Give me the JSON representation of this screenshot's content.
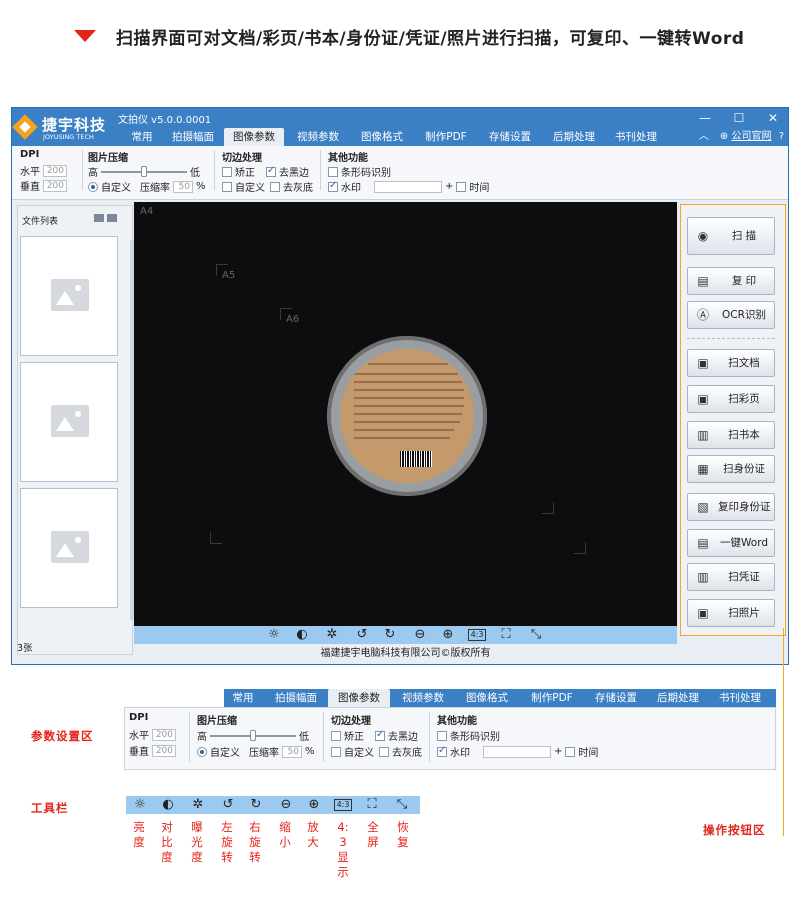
{
  "banner": {
    "text": "扫描界面可对文档/彩页/书本/身份证/凭证/照片进行扫描，可复印、一键转Word"
  },
  "app": {
    "logo_cn": "捷宇科技",
    "logo_en": "JOYUSING TECH",
    "title": "文拍仪 v5.0.0.0001",
    "tabs": [
      "常用",
      "拍摄幅面",
      "图像参数",
      "视频参数",
      "图像格式",
      "制作PDF",
      "存储设置",
      "后期处理",
      "书刊处理"
    ],
    "active_tab": "图像参数",
    "official_site": "公司官网",
    "colors": {
      "titlebar": "#3b7fc4",
      "accent": "#f5a623",
      "toolbar": "#9cc9ef",
      "annotation": "#e5231b"
    }
  },
  "params": {
    "dpi": {
      "title": "DPI",
      "h_label": "水平",
      "h_value": "200",
      "v_label": "垂直",
      "v_value": "200"
    },
    "compress": {
      "title": "图片压缩",
      "high": "高",
      "low": "低",
      "custom": "自定义",
      "rate_label": "压缩率",
      "rate_value": "50",
      "unit": "%",
      "level": 0.5
    },
    "crop": {
      "title": "切边处理",
      "correct": "矫正",
      "correct_checked": false,
      "remove_black": "去黑边",
      "remove_black_checked": true,
      "custom": "自定义",
      "custom_checked": false,
      "remove_gray": "去灰底",
      "remove_gray_checked": false
    },
    "other": {
      "title": "其他功能",
      "barcode": "条形码识别",
      "barcode_checked": false,
      "watermark": "水印",
      "watermark_checked": true,
      "plus": "+",
      "time": "时间",
      "time_checked": false
    }
  },
  "filelist": {
    "header": "文件列表",
    "count": "3张"
  },
  "preview": {
    "marks": [
      "A4",
      "A5",
      "A6"
    ]
  },
  "toolbar": {
    "icons": [
      "brightness-icon",
      "contrast-icon",
      "exposure-icon",
      "rotate-left-icon",
      "rotate-right-icon",
      "zoom-out-icon",
      "zoom-in-icon",
      "aspect-4-3-icon",
      "fullscreen-icon",
      "restore-icon"
    ],
    "aspect_label": "4:3"
  },
  "copyright": "福建捷宇电脑科技有限公司©版权所有",
  "ops": {
    "scan": "扫 描",
    "copy": "复 印",
    "ocr": "OCR识别",
    "doc": "扫文档",
    "color": "扫彩页",
    "book": "扫书本",
    "id": "扫身份证",
    "copy_id": "复印身份证",
    "word": "一键Word",
    "voucher": "扫凭证",
    "photo": "扫照片"
  },
  "annotations": {
    "param_area": "参数设置区",
    "toolbar_area": "工具栏",
    "op_area": "操作按钮区",
    "toolbar_labels": [
      "亮度",
      "对比度",
      "曝光度",
      "左旋转",
      "右旋转",
      "缩小",
      "放大",
      "4:3显示",
      "全屏",
      "恢复"
    ]
  }
}
